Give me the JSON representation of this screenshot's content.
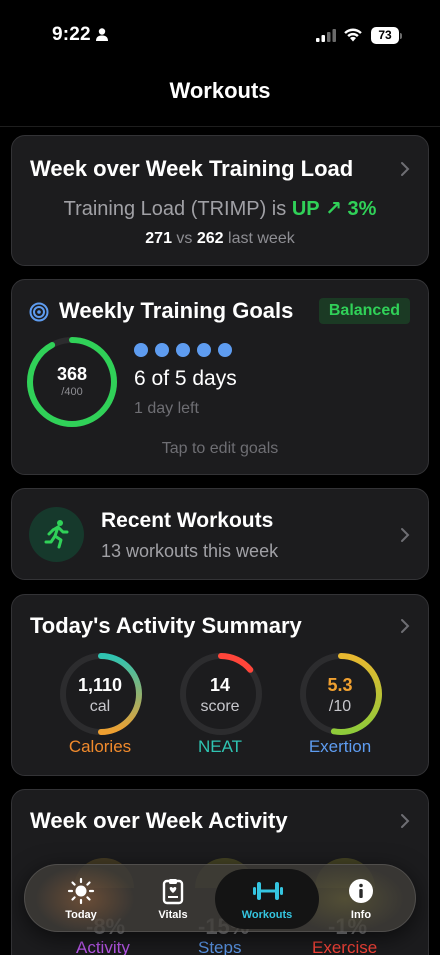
{
  "status_bar": {
    "time": "9:22",
    "battery": "73"
  },
  "nav": {
    "title": "Workouts"
  },
  "training_load": {
    "title": "Week over Week Training Load",
    "prefix": "Training Load (TRIMP) is ",
    "direction": "UP",
    "arrow": "↗",
    "change": "3%",
    "current": "271",
    "vs": "vs",
    "previous": "262",
    "suffix": "last week"
  },
  "goals": {
    "title": "Weekly Training Goals",
    "badge": "Balanced",
    "ring_value": "368",
    "ring_total": "/400",
    "ring_progress": 0.92,
    "dots_filled": 5,
    "days_text": "6 of 5 days",
    "days_left": "1 day left",
    "edit_hint": "Tap to edit goals"
  },
  "recent": {
    "title": "Recent Workouts",
    "subtitle": "13 workouts this week"
  },
  "activity": {
    "title": "Today's Activity Summary",
    "gauges": [
      {
        "value": "1,110",
        "unit": "cal",
        "label": "Calories",
        "color": "#f08a2c",
        "fill": 0.5
      },
      {
        "value": "14",
        "unit": "score",
        "label": "NEAT",
        "color": "#2fc4b2",
        "fill": 0.14
      },
      {
        "value": "5.3",
        "unit": "/10",
        "label": "Exertion",
        "color": "#5e9cf0",
        "fill": 0.53
      }
    ]
  },
  "wow_activity": {
    "title": "Week over Week Activity",
    "items": [
      {
        "value": "-8%",
        "label": "Activity",
        "color": "#bf5af2"
      },
      {
        "value": "-15%",
        "label": "Steps",
        "color": "#5e9cf0"
      },
      {
        "value": "-1%",
        "label": "Exercise",
        "color": "#ff453a"
      }
    ]
  },
  "tabbar": {
    "tabs": [
      {
        "label": "Today"
      },
      {
        "label": "Vitals"
      },
      {
        "label": "Workouts"
      },
      {
        "label": "Info"
      }
    ],
    "active_color": "#35c5e0"
  }
}
